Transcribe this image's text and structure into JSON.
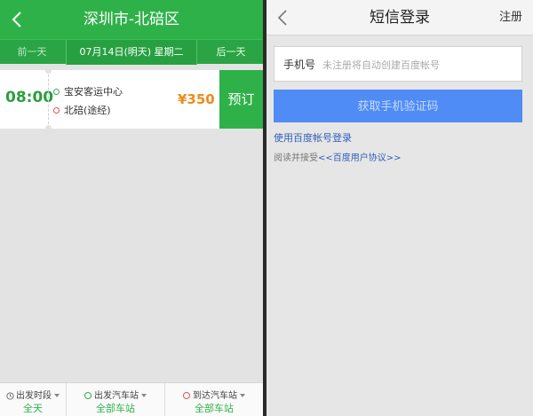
{
  "left_pane": {
    "title": "深圳市-北碚区",
    "date_nav": {
      "prev_label": "前一天",
      "current_date": "07月14日(明天) 星期二",
      "next_label": "后一天"
    },
    "trip": {
      "time": "08:00",
      "from_station": "宝安客运中心",
      "to_station": "北碚(途经)",
      "price": "¥350",
      "book_label": "预订"
    },
    "filters": [
      {
        "label": "出发时段",
        "value": "全天",
        "icon": "clock-icon"
      },
      {
        "label": "出发汽车站",
        "value": "全部车站",
        "icon": "origin-circle-icon"
      },
      {
        "label": "到达汽车站",
        "value": "全部车站",
        "icon": "destination-circle-icon"
      }
    ]
  },
  "right_pane": {
    "title": "短信登录",
    "register_label": "注册",
    "phone_label": "手机号",
    "phone_placeholder": "未注册将自动创建百度帐号",
    "phone_value": "",
    "get_code_label": "获取手机验证码",
    "baidu_login_link": "使用百度帐号登录",
    "agreement_prefix": "阅读并接受",
    "agreement_link": "<<百度用户协议>>"
  },
  "colors": {
    "green": "#2fb14a",
    "price_orange": "#f08a1d",
    "button_blue": "#4f8cf5",
    "link_blue": "#2f5fb8",
    "origin_green": "#2fb14a",
    "destination_red": "#e0544e"
  }
}
